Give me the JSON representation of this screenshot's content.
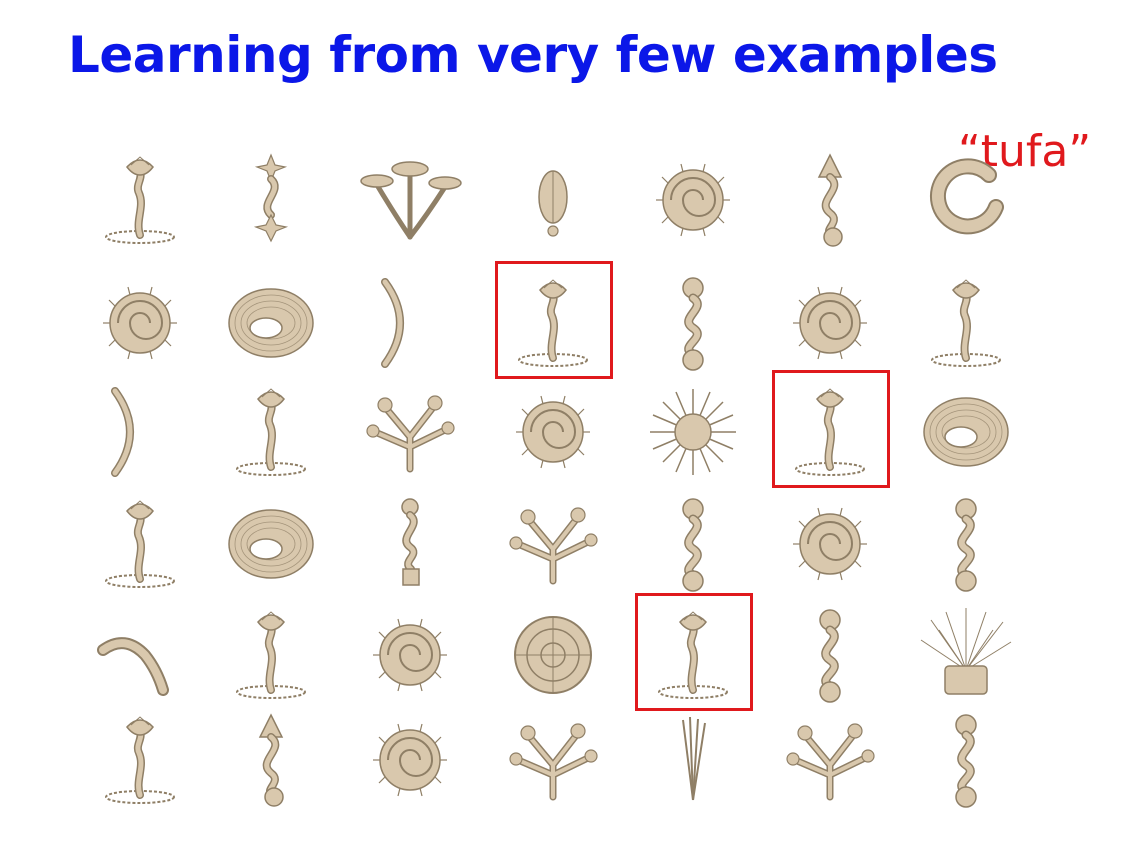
{
  "slide": {
    "title": "Learning from very few examples",
    "label": "“tufa”",
    "colors": {
      "title": "#0b17e8",
      "label": "#e0191d",
      "highlight": "#e0191d",
      "object_fill": "#d9c8ad",
      "object_shade": "#8f7f66"
    }
  },
  "objects": [
    {
      "shape": "tufa-plant"
    },
    {
      "shape": "wavy-star"
    },
    {
      "shape": "mushroom-cluster"
    },
    {
      "shape": "pod"
    },
    {
      "shape": "spiral-shell"
    },
    {
      "shape": "wavy-cone"
    },
    {
      "shape": "swirl"
    },
    {
      "shape": "spiral-shell"
    },
    {
      "shape": "torus"
    },
    {
      "shape": "arc-ribbon"
    },
    {
      "shape": "tufa-plant",
      "highlight": true
    },
    {
      "shape": "wavy-balls"
    },
    {
      "shape": "spiral-shell"
    },
    {
      "shape": "tufa-plant"
    },
    {
      "shape": "arc-ribbon"
    },
    {
      "shape": "tufa-plant"
    },
    {
      "shape": "branching-tree"
    },
    {
      "shape": "spiral-shell"
    },
    {
      "shape": "spiky-ball"
    },
    {
      "shape": "tufa-plant",
      "highlight": true
    },
    {
      "shape": "torus"
    },
    {
      "shape": "tufa-plant"
    },
    {
      "shape": "torus"
    },
    {
      "shape": "wavy-cylinder"
    },
    {
      "shape": "branching-tree"
    },
    {
      "shape": "wavy-balls"
    },
    {
      "shape": "spiral-shell"
    },
    {
      "shape": "wavy-balls"
    },
    {
      "shape": "horn"
    },
    {
      "shape": "tufa-plant"
    },
    {
      "shape": "spiral-shell"
    },
    {
      "shape": "disc"
    },
    {
      "shape": "tufa-plant",
      "highlight": true
    },
    {
      "shape": "wavy-balls"
    },
    {
      "shape": "bush"
    },
    {
      "shape": "tufa-plant"
    },
    {
      "shape": "wavy-cone"
    },
    {
      "shape": "spiral-shell"
    },
    {
      "shape": "branching-tree"
    },
    {
      "shape": "feather"
    },
    {
      "shape": "branching-tree"
    },
    {
      "shape": "wavy-balls"
    }
  ]
}
